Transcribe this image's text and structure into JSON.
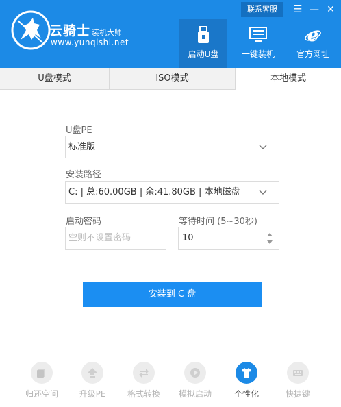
{
  "header": {
    "brand_name": "云骑士",
    "brand_sub": "装机大师",
    "brand_url": "www.yunqishi.net",
    "service_label": "联系客服",
    "menu_glyph": "☰",
    "minimize_glyph": "—",
    "close_glyph": "✕",
    "nav": [
      {
        "label": "启动U盘",
        "icon": "usb-drive-icon"
      },
      {
        "label": "一键装机",
        "icon": "monitor-icon"
      },
      {
        "label": "官方网址",
        "icon": "ie-browser-icon"
      }
    ],
    "colors": {
      "header_bg": "#1c8ae6",
      "active_nav": "#1a77c9"
    }
  },
  "mode_tabs": [
    {
      "label": "U盘模式"
    },
    {
      "label": "ISO模式"
    },
    {
      "label": "本地模式",
      "active": true
    }
  ],
  "form": {
    "upe_label": "U盘PE",
    "upe_value": "标准版",
    "path_label": "安装路径",
    "path_value": "C: | 总:60.00GB | 余:41.80GB | 本地磁盘",
    "password_label": "启动密码",
    "password_placeholder": "空则不设置密码",
    "wait_label": "等待时间 (5~30秒)",
    "wait_value": "10"
  },
  "install_button": "安装到 C 盘",
  "tools": [
    {
      "label": "归还空间",
      "icon": "restore-space-icon"
    },
    {
      "label": "升级PE",
      "icon": "upgrade-icon"
    },
    {
      "label": "格式转换",
      "icon": "convert-icon"
    },
    {
      "label": "模拟启动",
      "icon": "play-icon"
    },
    {
      "label": "个性化",
      "icon": "tshirt-icon",
      "active": true
    },
    {
      "label": "快捷键",
      "icon": "keyboard-icon"
    }
  ],
  "accent_color": "#1b8ef2"
}
